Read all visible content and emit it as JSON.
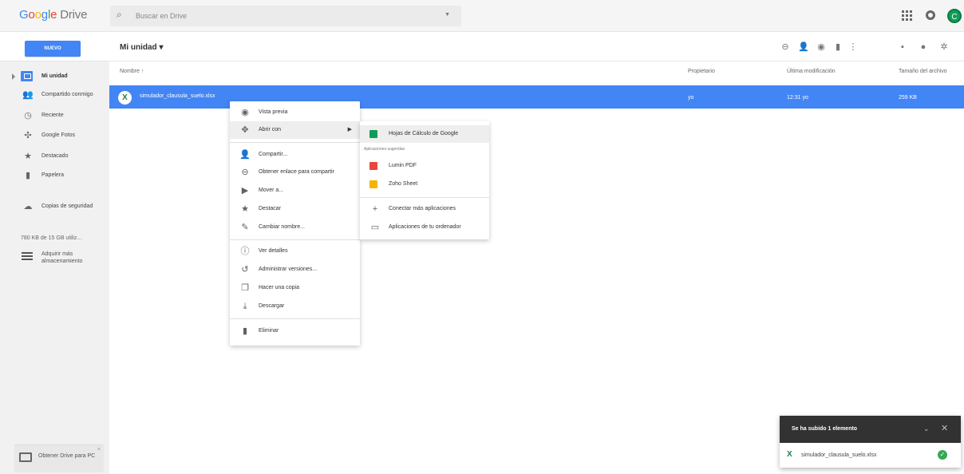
{
  "header": {
    "logo_google": "Google",
    "logo_drive": "Drive",
    "search_placeholder": "Buscar en Drive",
    "avatar_letter": "C"
  },
  "toolbar": {
    "new_label": "NUEVO",
    "folder_title": "Mi unidad ▾"
  },
  "sidebar": {
    "items": [
      {
        "label": "Mi unidad",
        "icon": "drive-icon"
      },
      {
        "label": "Compartido conmigo",
        "icon": "shared-icon"
      },
      {
        "label": "Reciente",
        "icon": "clock-icon"
      },
      {
        "label": "Google Fotos",
        "icon": "photos-icon"
      },
      {
        "label": "Destacado",
        "icon": "star-icon"
      },
      {
        "label": "Papelera",
        "icon": "trash-icon"
      },
      {
        "label": "Copias de seguridad",
        "icon": "cloud-icon"
      }
    ],
    "storage_text": "780 KB de 15 GB utiliz...",
    "buy_storage": "Adquirir más almacenamiento",
    "get_drive": "Obtener Drive para PC",
    "get_drive_close": "×"
  },
  "columns": {
    "name": "Nombre ↑",
    "owner": "Propietario",
    "modified": "Última modificación",
    "size": "Tamaño del archivo"
  },
  "files": [
    {
      "name": "simulador_clausula_suelo.xlsx",
      "owner": "yo",
      "modified": "12:31 yo",
      "size": "259 KB"
    }
  ],
  "context_menu": {
    "items": [
      {
        "label": "Vista previa",
        "icon": "eye-icon"
      },
      {
        "label": "Abrir con",
        "icon": "open-with-icon"
      },
      {
        "label": "Compartir...",
        "icon": "share-icon"
      },
      {
        "label": "Obtener enlace para compartir",
        "icon": "link-icon"
      },
      {
        "label": "Mover a...",
        "icon": "move-icon"
      },
      {
        "label": "Destacar",
        "icon": "star-icon"
      },
      {
        "label": "Cambiar nombre...",
        "icon": "rename-icon"
      },
      {
        "label": "Ver detalles",
        "icon": "info-icon"
      },
      {
        "label": "Administrar versiones...",
        "icon": "history-icon"
      },
      {
        "label": "Hacer una copia",
        "icon": "copy-icon"
      },
      {
        "label": "Descargar",
        "icon": "download-icon"
      },
      {
        "label": "Eliminar",
        "icon": "trash-icon"
      }
    ]
  },
  "submenu": {
    "primary": "Hojas de Cálculo de Google",
    "suggested_label": "Aplicaciones sugeridas",
    "suggested": [
      "Lumin PDF",
      "Zoho Sheet"
    ],
    "connect": "Conectar más aplicaciones",
    "computer_apps": "Aplicaciones de tu ordenador"
  },
  "upload": {
    "title": "Se ha subido 1 elemento",
    "file": "simulador_clausula_suelo.xlsx"
  },
  "colors": {
    "accent": "#4285f4",
    "excel": "#1e7e45",
    "success": "#34a853"
  }
}
